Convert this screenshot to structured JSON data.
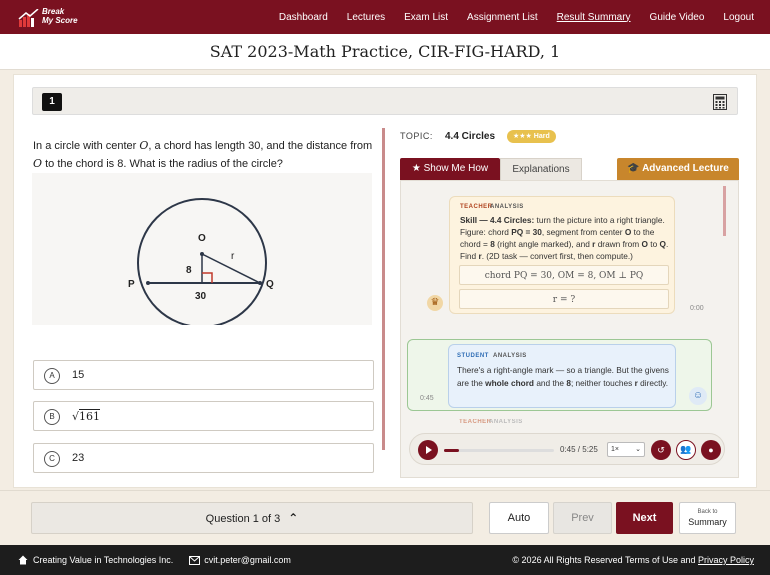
{
  "brand": {
    "line1": "Break",
    "line2": "My Score"
  },
  "nav": {
    "items": [
      {
        "label": "Dashboard"
      },
      {
        "label": "Lectures"
      },
      {
        "label": "Exam List"
      },
      {
        "label": "Assignment List"
      },
      {
        "label": "Result Summary",
        "active": true
      },
      {
        "label": "Guide Video"
      },
      {
        "label": "Logout"
      }
    ]
  },
  "page": {
    "title": "SAT 2023-Math Practice, CIR-FIG-HARD, 1"
  },
  "question": {
    "number": "1",
    "text_before_o1": "In a circle with center ",
    "o1": "O",
    "text_mid": ", a chord has length 30, and the distance from ",
    "o2": "O",
    "text_after": " to the chord is 8. What is the radius of the circle?",
    "figure": {
      "labels": {
        "center": "O",
        "left": "P",
        "right": "Q",
        "radius": "r",
        "distance": "8",
        "chord": "30"
      }
    },
    "choices": [
      {
        "letter": "A",
        "text": "15"
      },
      {
        "letter": "B",
        "radicand": "161"
      },
      {
        "letter": "C",
        "text": "23"
      }
    ]
  },
  "topic": {
    "label": "TOPIC:",
    "value": "4.4 Circles",
    "difficulty": "★★★ Hard"
  },
  "tabs": {
    "show_me_how": "★  Show Me How",
    "explanations": "Explanations",
    "advanced": "Advanced Lecture"
  },
  "chat": {
    "teacher": {
      "role": "TEACHER",
      "tag": "ANALYSIS",
      "skill_label": "Skill — 4.4 Circles:",
      "p1": " turn the picture into a right triangle. Figure: chord ",
      "b1": "PQ = 30",
      "p2": ", segment from center ",
      "b2": "O",
      "p3": " to the chord = ",
      "b3": "8",
      "p4": " (right angle marked), and ",
      "b4": "r",
      "p5": " drawn from ",
      "b5": "O",
      "p6": " to ",
      "b6": "Q",
      "p7": ". Find ",
      "b7": "r",
      "p8": ". (2D task — convert first, then compute.)",
      "math1": "chord PQ = 30,    OM = 8,    OM ⊥ PQ",
      "math2": "r = ?",
      "time": "0:00"
    },
    "student": {
      "role": "STUDENT",
      "tag": "ANALYSIS",
      "p1": "There's a right-angle mark — so a triangle. But the givens are the ",
      "b1": "whole chord",
      "p2": " and the ",
      "b2": "8",
      "p3": "; neither touches ",
      "b3": "r",
      "p4": " directly.",
      "time": "0:45"
    },
    "next": {
      "role": "TEACHER",
      "tag": "ANALYSIS"
    }
  },
  "player": {
    "time": "0:45 / 5:25",
    "speed": "1×",
    "progress": 0.14
  },
  "bottom": {
    "pager": "Question  1 of 3",
    "auto": "Auto",
    "prev": "Prev",
    "next": "Next",
    "summary_small": "Back to",
    "summary": "Summary"
  },
  "footer": {
    "company": "Creating Value in Technologies Inc.",
    "email": "cvit.peter@gmail.com",
    "copyright": "© 2026 All Rights Reserved Terms of Use and ",
    "privacy": "Privacy Policy"
  },
  "colors": {
    "brand": "#7a1120",
    "accent_gold": "#c8862c",
    "badge_gold": "#e8c14e"
  }
}
